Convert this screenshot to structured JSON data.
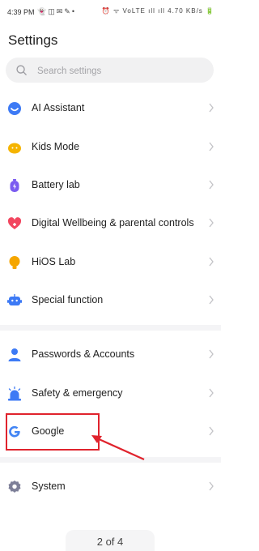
{
  "status_bar": {
    "time": "4:39 PM",
    "left_icons": [
      "snapchat-icon",
      "instagram-icon",
      "message-icon",
      "tool-icon",
      "dot-icon"
    ],
    "right_text": "⏰ ᯤ VoLTE ıll ıll 4.70 KB/s 🔋"
  },
  "title": "Settings",
  "search": {
    "placeholder": "Search settings",
    "value": ""
  },
  "items": [
    {
      "label": "AI Assistant",
      "icon": "ai-assistant-icon",
      "color": "#3d7af5"
    },
    {
      "label": "Kids Mode",
      "icon": "kids-mode-icon",
      "color": "#f5b400"
    },
    {
      "label": "Battery lab",
      "icon": "battery-icon",
      "color": "#7b5cf0"
    },
    {
      "label": "Digital Wellbeing & parental controls",
      "icon": "heart-icon",
      "color": "#f2465f"
    },
    {
      "label": "HiOS Lab",
      "icon": "bulb-icon",
      "color": "#f5a600"
    },
    {
      "label": "Special function",
      "icon": "robot-icon",
      "color": "#3d7af5"
    },
    {
      "label": "Passwords & Accounts",
      "icon": "person-icon",
      "color": "#3d7af5"
    },
    {
      "label": "Safety & emergency",
      "icon": "alarm-icon",
      "color": "#3d7af5"
    },
    {
      "label": "Google",
      "icon": "google-icon",
      "color": "#4285f4"
    },
    {
      "label": "System",
      "icon": "gear-icon",
      "color": "#7d7f98"
    }
  ],
  "page_indicator": "2 of 4",
  "annotation_color": "#e0232d"
}
